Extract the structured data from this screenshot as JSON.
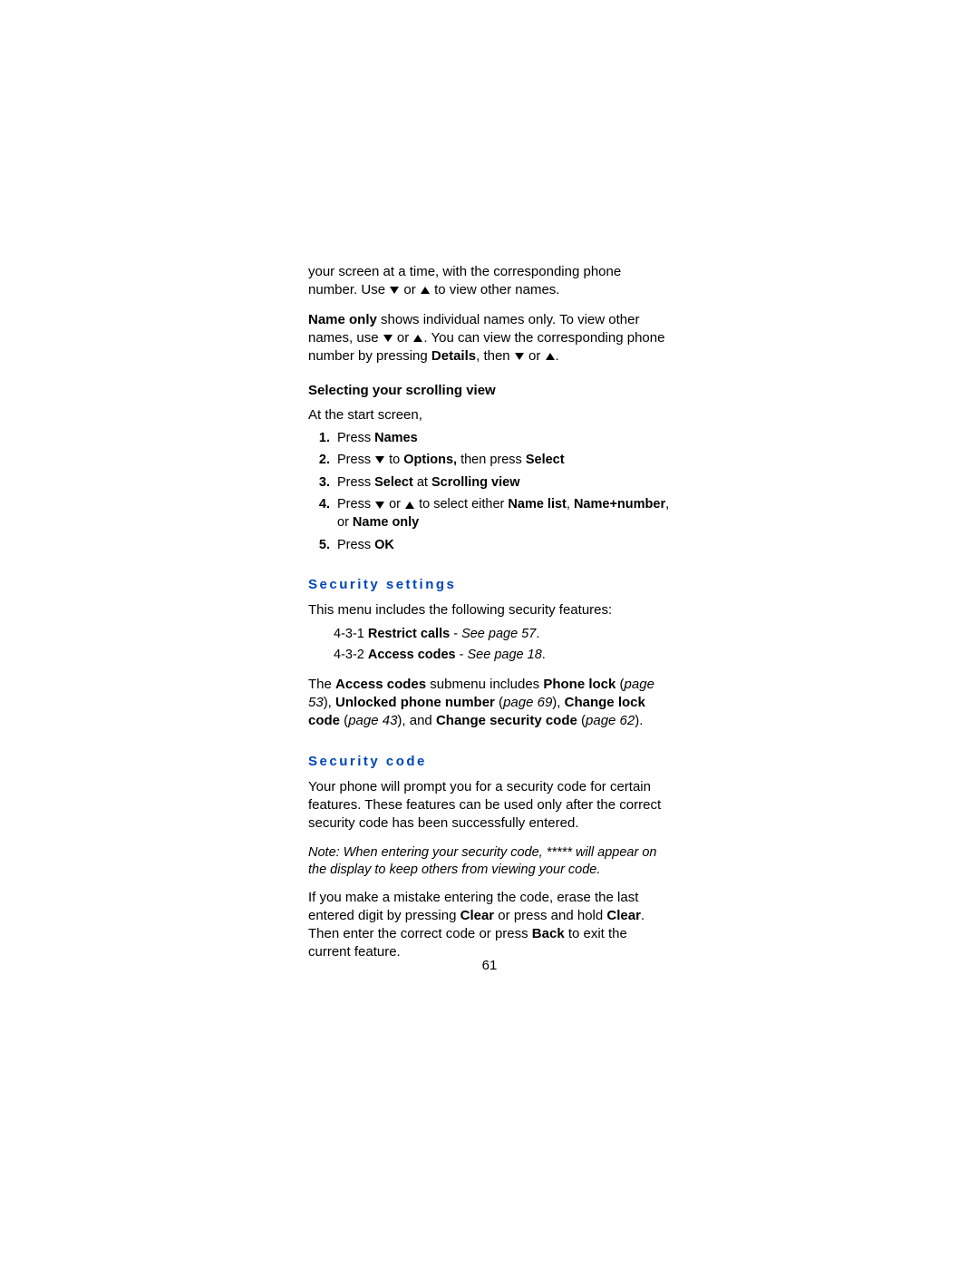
{
  "intro": {
    "p1_a": "your screen at a time, with the corresponding phone number. Use ",
    "p1_b": " or ",
    "p1_c": " to view other names.",
    "p2_bold": "Name only",
    "p2_a": " shows individual names only. To view other names, use ",
    "p2_b": " or ",
    "p2_c": ". You can view the corresponding phone number by pressing ",
    "p2_bold2": "Details",
    "p2_d": ", then ",
    "p2_e": " or ",
    "p2_f": "."
  },
  "selecting": {
    "heading": "Selecting your scrolling view",
    "lead": "At the start screen,",
    "s1_a": "Press ",
    "s1_bold": "Names",
    "s2_a": "Press ",
    "s2_b": " to ",
    "s2_bold1": "Options,",
    "s2_c": " then press ",
    "s2_bold2": "Select",
    "s3_a": "Press ",
    "s3_bold1": "Select",
    "s3_b": " at ",
    "s3_bold2": "Scrolling view",
    "s4_a": "Press ",
    "s4_b": " or ",
    "s4_c": " to select either ",
    "s4_bold1": "Name list",
    "s4_d": ", ",
    "s4_bold2": "Name+number",
    "s4_e": ", or ",
    "s4_bold3": "Name only",
    "s5_a": "Press ",
    "s5_bold": "OK"
  },
  "security_settings": {
    "heading": "Security settings",
    "lead": "This menu includes the following security features:",
    "i1_a": "4-3-1 ",
    "i1_bold": "Restrict calls",
    "i1_b": " - ",
    "i1_it": "See page 57",
    "i1_c": ".",
    "i2_a": "4-3-2 ",
    "i2_bold": "Access codes",
    "i2_b": " - ",
    "i2_it": "See page 18",
    "i2_c": ".",
    "sub_a": "The ",
    "sub_bold1": "Access codes",
    "sub_b": " submenu includes ",
    "sub_bold2": "Phone lock",
    "sub_c": " (",
    "sub_it1": "page 53",
    "sub_d": "), ",
    "sub_bold3": "Unlocked phone number",
    "sub_e": " (",
    "sub_it2": "page 69",
    "sub_f": "), ",
    "sub_bold4": "Change lock code",
    "sub_g": " (",
    "sub_it3": "page 43",
    "sub_h": "), and ",
    "sub_bold5": "Change security code",
    "sub_i": " (",
    "sub_it4": "page 62",
    "sub_j": ")."
  },
  "security_code": {
    "heading": "Security code",
    "p1": "Your phone will prompt you for a security code for certain features. These features can be used only after the correct security code has been successfully entered.",
    "note": "Note: When entering your security code, ***** will appear on the display to keep others from viewing your code.",
    "p2_a": "If you make a mistake entering the code, erase the last entered digit by pressing ",
    "p2_bold1": "Clear",
    "p2_b": " or press and hold ",
    "p2_bold2": "Clear",
    "p2_c": ". Then enter the correct code or press ",
    "p2_bold3": "Back",
    "p2_d": " to exit the current feature."
  },
  "page_number": "61"
}
